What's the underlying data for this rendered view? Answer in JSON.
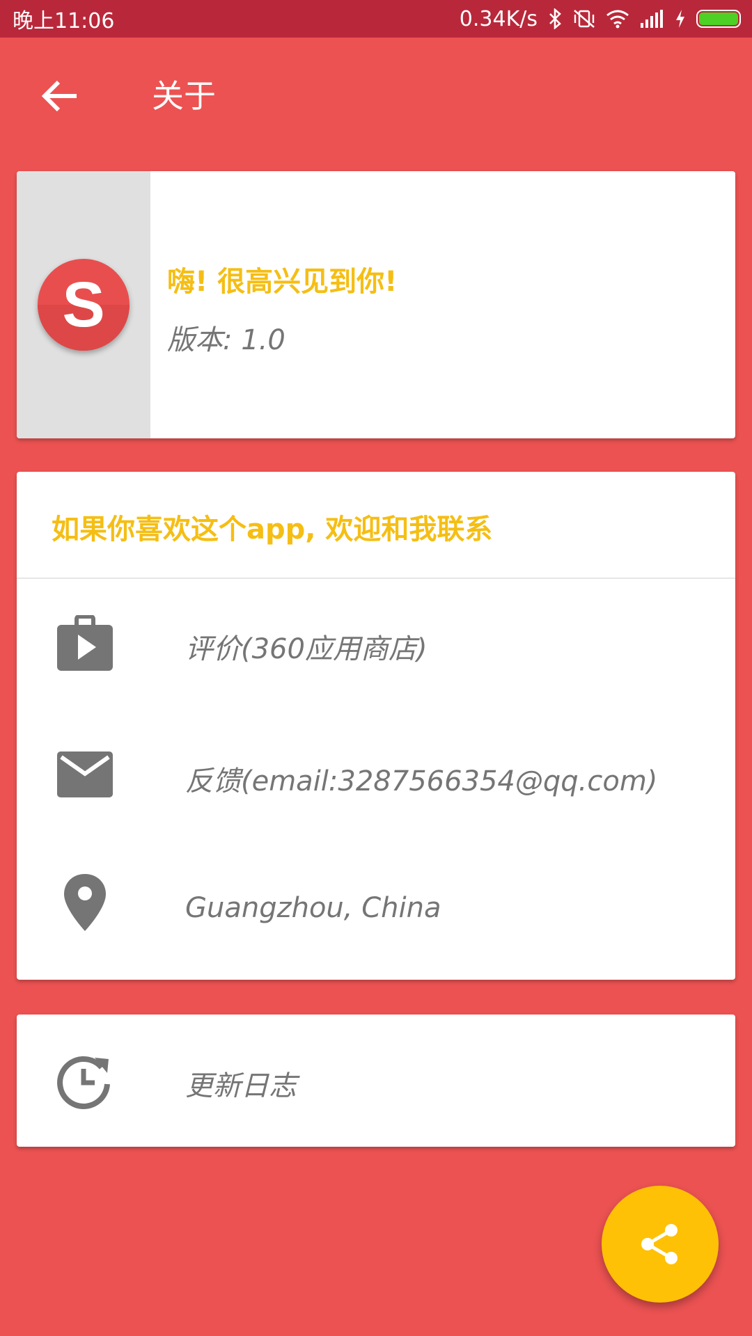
{
  "status_bar": {
    "time": "晚上11:06",
    "net_speed": "0.34K/s",
    "icons": [
      "bluetooth-icon",
      "vibrate-off-icon",
      "wifi-icon",
      "signal-icon",
      "charging-icon",
      "battery-icon"
    ],
    "battery_color": "#4cd124"
  },
  "toolbar": {
    "title": "关于",
    "back_icon": "arrow-back-icon"
  },
  "hello_card": {
    "logo_letter": "S",
    "title": "嗨! 很高兴见到你!",
    "version": "版本: 1.0"
  },
  "contact_card": {
    "header": "如果你喜欢这个app, 欢迎和我联系",
    "items": [
      {
        "icon": "play-store-bag-icon",
        "label": "评价(360应用商店)"
      },
      {
        "icon": "email-icon",
        "label": "反馈(email:3287566354@qq.com)"
      },
      {
        "icon": "location-pin-icon",
        "label": "Guangzhou, China"
      }
    ]
  },
  "log_card": {
    "icon": "update-history-icon",
    "label": "更新日志"
  },
  "fab": {
    "icon": "share-icon"
  },
  "colors": {
    "background": "#ec5252",
    "status_bar": "#b9283a",
    "accent": "#f5be14",
    "fab": "#fec106"
  }
}
